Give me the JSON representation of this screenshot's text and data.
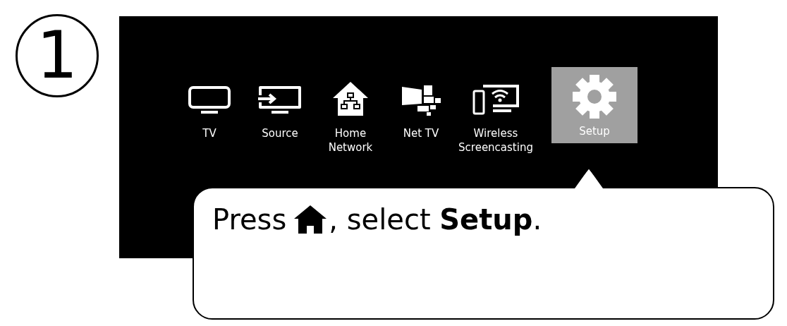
{
  "step": {
    "number": "1"
  },
  "menu": {
    "items": [
      {
        "kind": "tv",
        "label": "TV",
        "selected": false
      },
      {
        "kind": "source",
        "label": "Source",
        "selected": false
      },
      {
        "kind": "home-network",
        "label": "Home\nNetwork",
        "selected": false
      },
      {
        "kind": "net-tv",
        "label": "Net TV",
        "selected": false
      },
      {
        "kind": "screencast",
        "label": "Wireless\nScreencasting",
        "selected": false
      },
      {
        "kind": "setup",
        "label": "Setup",
        "selected": true
      }
    ]
  },
  "callout": {
    "before": "Press",
    "after": ", select **Setup**."
  }
}
